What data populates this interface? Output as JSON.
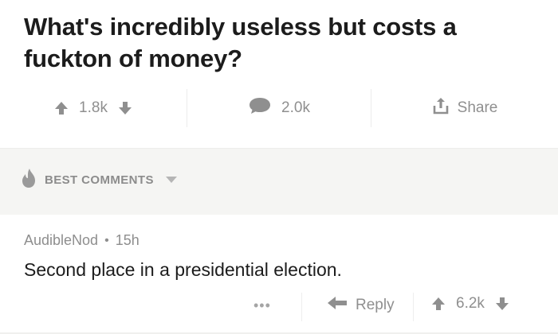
{
  "post": {
    "title": "What's incredibly useless but costs a fuckton of money?",
    "vote_count": "1.8k",
    "comment_count": "2.0k",
    "share_label": "Share"
  },
  "sort": {
    "label": "BEST COMMENTS"
  },
  "comment": {
    "author": "AudibleNod",
    "separator": "•",
    "age": "15h",
    "body": "Second place in a presidential election.",
    "more_label": "•••",
    "reply_label": "Reply",
    "vote_count": "6.2k"
  },
  "icons": {
    "upvote": "arrow-up-icon",
    "downvote": "arrow-down-icon",
    "comment": "speech-bubble-icon",
    "share": "share-icon",
    "sort": "flame-icon",
    "caret": "chevron-down-icon",
    "reply": "reply-arrow-icon"
  },
  "colors": {
    "icon_gray": "#8f8f8f",
    "band_bg": "#f5f5f3",
    "title_text": "#1c1c1c"
  }
}
